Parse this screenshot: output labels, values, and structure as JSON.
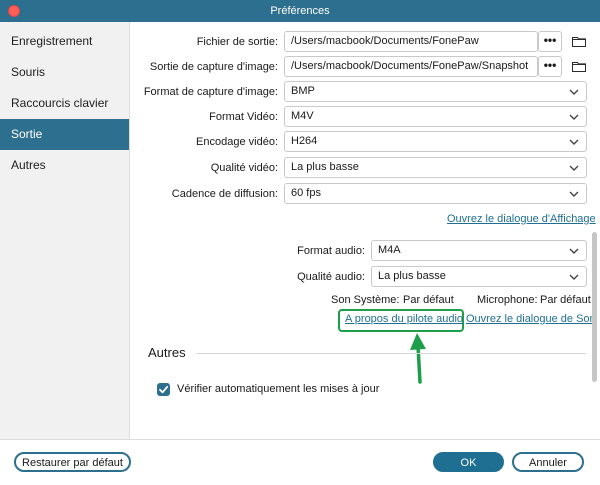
{
  "window": {
    "title": "Préférences"
  },
  "sidebar": {
    "items": [
      {
        "label": "Enregistrement",
        "active": false
      },
      {
        "label": "Souris",
        "active": false
      },
      {
        "label": "Raccourcis clavier",
        "active": false
      },
      {
        "label": "Sortie",
        "active": true
      },
      {
        "label": "Autres",
        "active": false
      }
    ]
  },
  "output": {
    "file_label": "Fichier de sortie:",
    "file_value": "/Users/macbook/Documents/FonePaw",
    "capture_label": "Sortie de capture d'image:",
    "capture_value": "/Users/macbook/Documents/FonePaw/Snapshot",
    "dots": "•••",
    "image_format_label": "Format de capture d'image:",
    "image_format_value": "BMP",
    "video_format_label": "Format Vidéo:",
    "video_format_value": "M4V",
    "video_codec_label": "Encodage vidéo:",
    "video_codec_value": "H264",
    "video_quality_label": "Qualité vidéo:",
    "video_quality_value": "La plus basse",
    "framerate_label": "Cadence de diffusion:",
    "framerate_value": "60 fps",
    "display_dialog_link": "Ouvrez le dialogue d'Affichage",
    "audio_format_label": "Format audio:",
    "audio_format_value": "M4A",
    "audio_quality_label": "Qualité audio:",
    "audio_quality_value": "La plus basse",
    "system_sound_label": "Son Système:",
    "system_sound_value": "Par défaut",
    "microphone_label": "Microphone:",
    "microphone_value": "Par défaut",
    "audio_driver_link": "A propos du pilote audio",
    "sound_dialog_link": "Ouvrez le dialogue de Son"
  },
  "others": {
    "title": "Autres",
    "auto_update_label": "Vérifier automatiquement les mises à jour",
    "auto_update_checked": true
  },
  "footer": {
    "restore_label": "Restaurer par défaut",
    "ok_label": "OK",
    "cancel_label": "Annuler"
  },
  "colors": {
    "accent": "#2d6f8e",
    "highlight": "#1d9e4a"
  }
}
